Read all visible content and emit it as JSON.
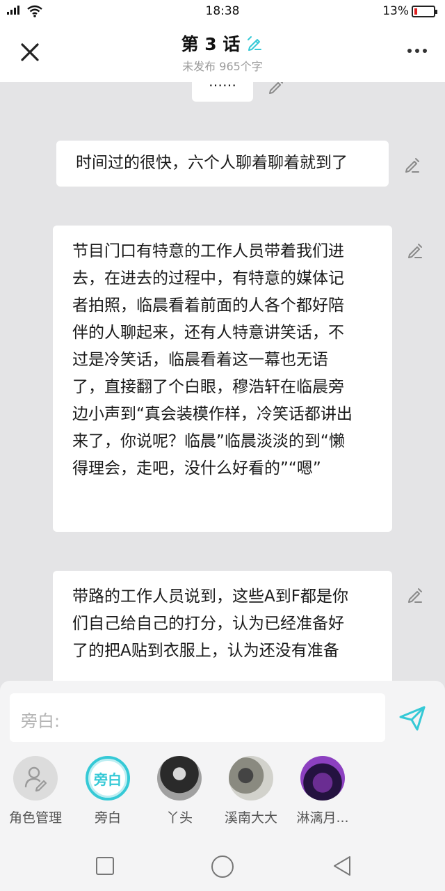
{
  "status_bar": {
    "time": "18:38",
    "battery_percent": "13%"
  },
  "header": {
    "title": "第 3 话",
    "subtitle": "未发布 965个字"
  },
  "messages": [
    {
      "text": "……"
    },
    {
      "text": "时间过的很快，六个人聊着聊着就到了"
    },
    {
      "lines": [
        "节目门口有特意的工作人员带着我们进",
        "去，在进去的过程中，有特意的媒体记",
        "者拍照，临晨看着前面的人各个都好陪",
        "伴的人聊起来，还有人特意讲笑话，不",
        "过是冷笑话，临晨看着这一幕也无语",
        "了，直接翻了个白眼，穆浩轩在临晨旁",
        "边小声到“真会装模作样，冷笑话都讲出",
        "来了，你说呢？临晨”临晨淡淡的到“懒",
        "得理会，走吧，没什么好看的”“嗯”"
      ]
    },
    {
      "lines": [
        "带路的工作人员说到，这些A到F都是你",
        "们自己给自己的打分，认为已经准备好",
        "了的把A贴到衣服上，认为还没有准备"
      ]
    }
  ],
  "input": {
    "placeholder": "旁白:"
  },
  "characters": [
    {
      "name": "角色管理"
    },
    {
      "name": "旁白",
      "avatar_text": "旁白"
    },
    {
      "name": "丫头"
    },
    {
      "name": "溪南大大"
    },
    {
      "name": "淋漓月..."
    }
  ],
  "colors": {
    "accent": "#35c9d6",
    "background": "#e4e4e6",
    "battery_low": "#e02020"
  }
}
